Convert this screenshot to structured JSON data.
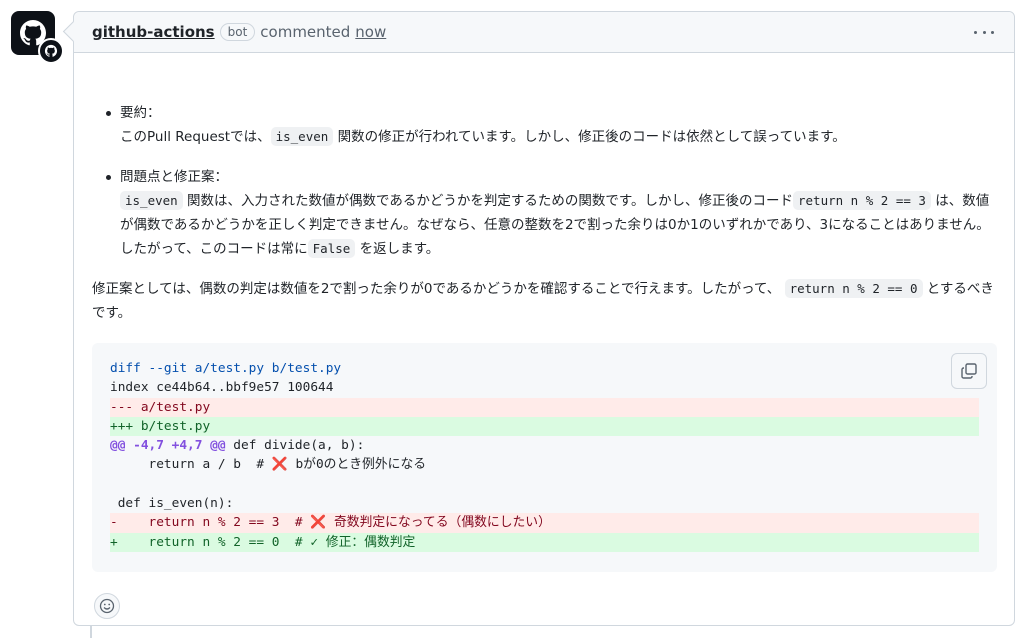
{
  "comment": {
    "author": "github-actions",
    "badge": "bot",
    "action": "commented",
    "time": "now"
  },
  "summary": {
    "title": "要約：",
    "text_1": "このPull Requestでは、",
    "code_1": "is_even",
    "text_2": "関数の修正が行われています。しかし、修正後のコードは依然として誤っています。"
  },
  "issues": {
    "title": "問題点と修正案：",
    "code_1": "is_even",
    "text_1": "関数は、入力された数値が偶数であるかどうかを判定するための関数です。しかし、修正後のコード",
    "code_2": "return n % 2 == 3",
    "text_2": "は、数値が偶数であるかどうかを正しく判定できません。なぜなら、任意の整数を2で割った余りは0か1のいずれかであり、3になることはありません。したがって、このコードは常に",
    "code_3": "False",
    "text_3": "を返します。"
  },
  "proposal": {
    "text_1": "修正案としては、偶数の判定は数値を2で割った余りが0であるかどうかを確認することで行えます。したがって、",
    "code_1": "return n % 2 == 0",
    "text_2": "とするべきです。"
  },
  "code_block": {
    "lines": [
      "diff --git a/test.py b/test.py",
      "index ce44b64..bbf9e57 100644",
      "--- a/test.py",
      "+++ b/test.py",
      "def divide(a, b):",
      "     return a / b  # ",
      "bが0のとき例外になる",
      " def is_even(n):",
      "-    return n % 2 == 3  # ",
      "奇数判定になってる（偶数にしたい）",
      "+    return n % 2 == 0  # ",
      "修正：偶数判定"
    ],
    "hunk_header": "@@ -4,7 +4,7 @@",
    "cross_mark": "❌",
    "check_mark": "✓"
  },
  "icons": {
    "avatar": "github-actions-icon",
    "more": "kebab-icon",
    "copy": "copy-icon",
    "reaction": "smiley-icon"
  }
}
